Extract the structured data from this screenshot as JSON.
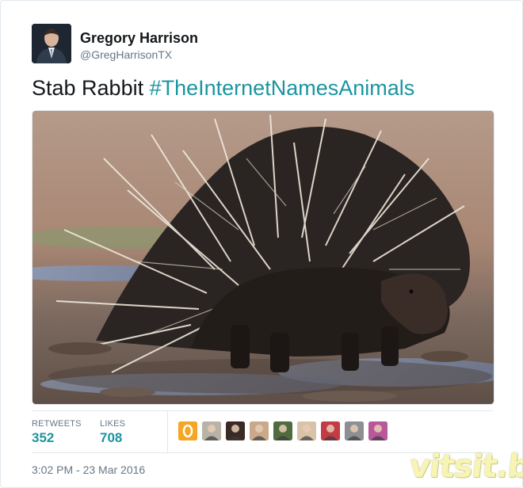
{
  "author": {
    "display_name": "Gregory Harrison",
    "handle": "@GregHarrisonTX"
  },
  "tweet": {
    "text": "Stab Rabbit ",
    "hashtag": "#TheInternetNamesAnimals",
    "hashtag_color": "#1b95a0"
  },
  "stats": {
    "retweets_label": "RETWEETS",
    "retweets_value": "352",
    "likes_label": "LIKES",
    "likes_value": "708"
  },
  "likers": [
    {
      "color": "#f5a623"
    },
    {
      "color": "#b9b2a6"
    },
    {
      "color": "#3b2a24"
    },
    {
      "color": "#c9a98a"
    },
    {
      "color": "#4f6b3f"
    },
    {
      "color": "#d8c3a8"
    },
    {
      "color": "#c23b45"
    },
    {
      "color": "#8d8f93"
    },
    {
      "color": "#b8579a"
    }
  ],
  "timestamp": "3:02 PM - 23 Mar 2016",
  "watermark": "vitsit.biz"
}
